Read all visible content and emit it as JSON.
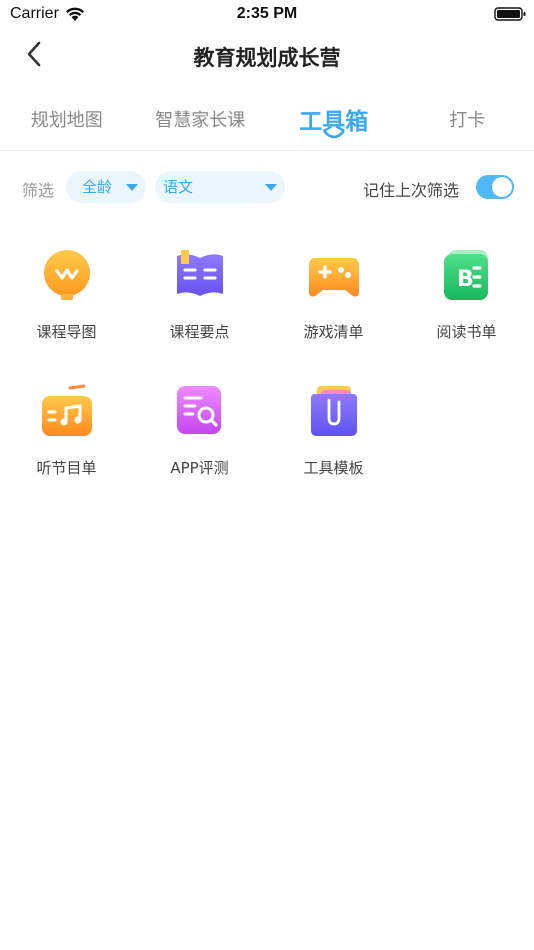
{
  "status_bar": {
    "carrier": "Carrier",
    "time": "2:35 PM"
  },
  "nav": {
    "title": "教育规划成长营"
  },
  "tabs": [
    {
      "label": "规划地图"
    },
    {
      "label": "智慧家长课"
    },
    {
      "label": "工具箱"
    },
    {
      "label": "打卡"
    }
  ],
  "active_tab": "工具箱",
  "filter": {
    "label": "筛选",
    "age": "全龄",
    "subject": "语文",
    "remember_label": "记住上次筛选",
    "remember_on": true
  },
  "colors": {
    "accent": "#3aaaf0",
    "select_bg": "#eaf5fd"
  },
  "tools": [
    {
      "label": "课程导图",
      "icon": "lightbulb-icon"
    },
    {
      "label": "课程要点",
      "icon": "book-icon"
    },
    {
      "label": "游戏清单",
      "icon": "gamepad-icon"
    },
    {
      "label": "阅读书单",
      "icon": "booklist-icon"
    },
    {
      "label": "听节目单",
      "icon": "radio-icon"
    },
    {
      "label": "APP评测",
      "icon": "search-doc-icon"
    },
    {
      "label": "工具模板",
      "icon": "folder-icon"
    }
  ]
}
